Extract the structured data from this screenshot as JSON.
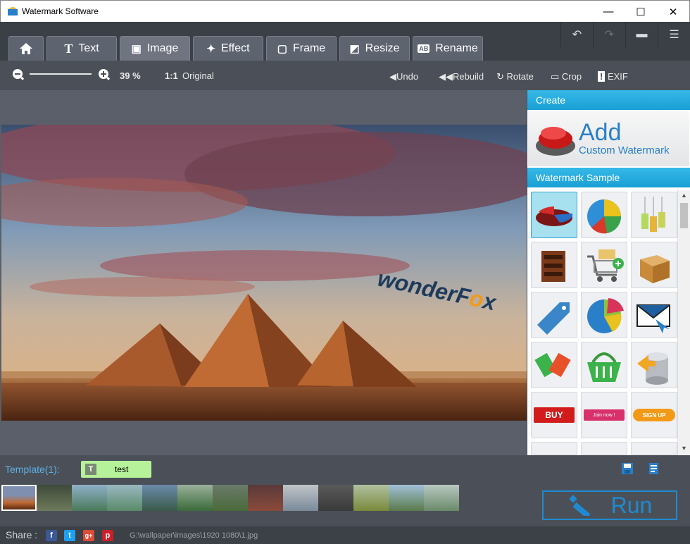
{
  "window": {
    "title": "Watermark Software",
    "minimize": "—",
    "maximize": "☐",
    "close": "✕"
  },
  "tabs": [
    {
      "label": "",
      "icon": "home-icon"
    },
    {
      "label": "Text",
      "icon": "text-icon",
      "glyph": "T"
    },
    {
      "label": "Image",
      "icon": "image-icon",
      "glyph": "▣"
    },
    {
      "label": "Effect",
      "icon": "magic-wand-icon",
      "glyph": "✦"
    },
    {
      "label": "Frame",
      "icon": "frame-icon",
      "glyph": "▢"
    },
    {
      "label": "Resize",
      "icon": "resize-icon",
      "glyph": "◩"
    },
    {
      "label": "Rename",
      "icon": "rename-icon",
      "glyph": "AB"
    }
  ],
  "toolbar": {
    "zoom": "39 %",
    "original_icon": "1:1",
    "original": "Original",
    "undo": "Undo",
    "rebuild": "Rebuild",
    "rotate": "Rotate",
    "crop": "Crop",
    "exif": "EXIF"
  },
  "watermark_text": {
    "before": "wonderF",
    "o": "o",
    "after": "x"
  },
  "side": {
    "create_header": "Create",
    "add": "Add",
    "custom": "Custom Watermark",
    "sample_header": "Watermark Sample",
    "buy": "BUY",
    "join": "Join now !",
    "signup": "SIGN UP"
  },
  "template": {
    "label": "Template(1):",
    "item": "test",
    "item_icon": "T"
  },
  "run": "Run",
  "share": {
    "label": "Share :",
    "path": "G:\\wallpaper\\images\\1920 1080\\1.jpg",
    "facebook": "f",
    "twitter": "t",
    "gplus": "g+",
    "pinterest": "p"
  },
  "colors": {
    "accent": "#1f8ad1",
    "header": "#1a9fd5",
    "template": "#b6f29a"
  }
}
